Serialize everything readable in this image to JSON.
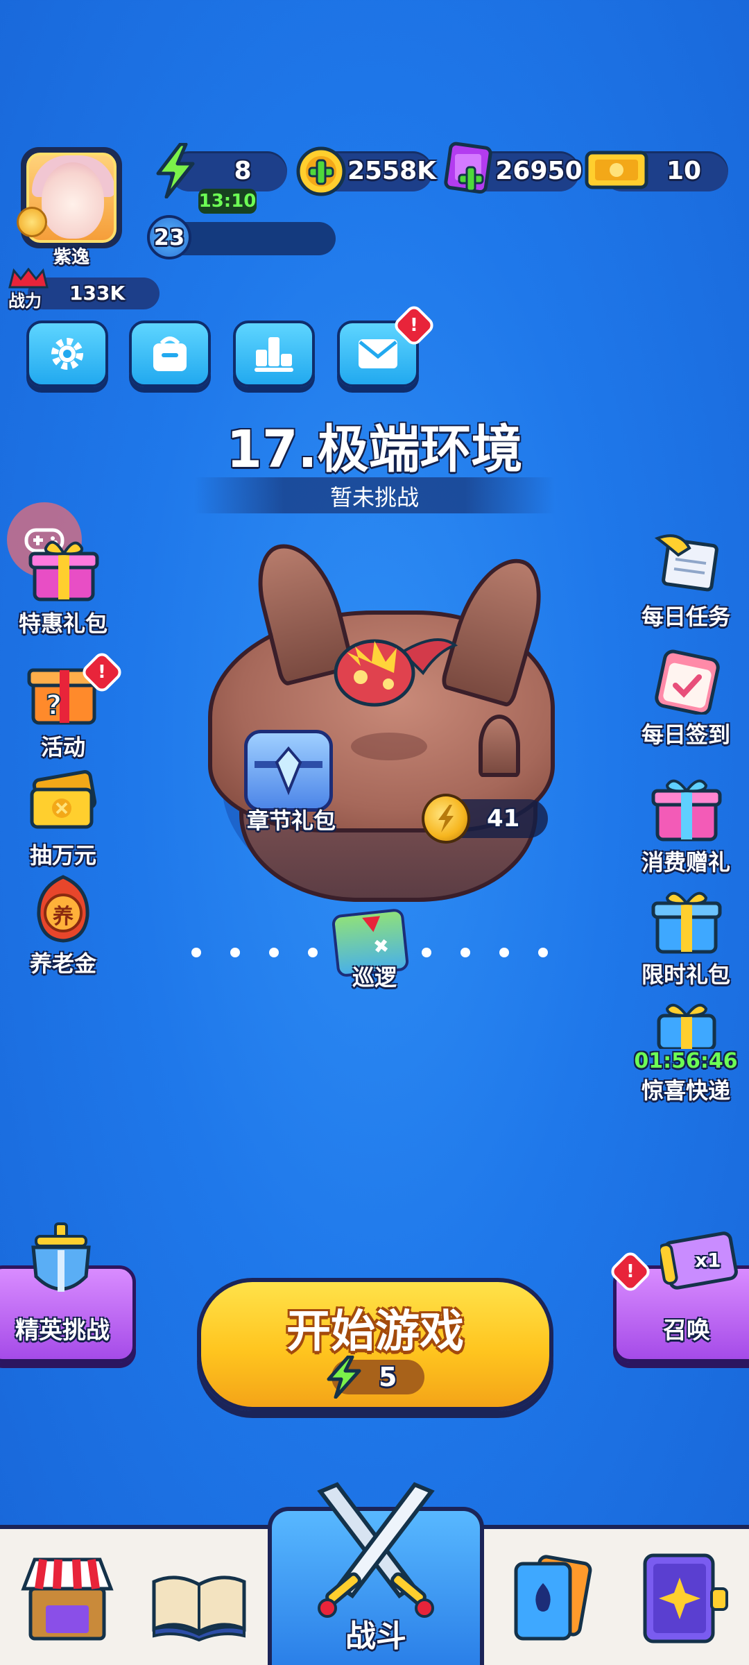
{
  "player": {
    "name": "紫逸",
    "level": "23",
    "level_progress": 0.12,
    "power_label": "战力",
    "power_value": "133K"
  },
  "resources": {
    "energy": "8",
    "energy_timer": "13:10",
    "coins": "2558K",
    "gems": "26950",
    "tickets": "10"
  },
  "menu_buttons": [
    "settings-icon",
    "shop-bag-icon",
    "leaderboard-icon",
    "mail-icon"
  ],
  "stage": {
    "title": "17.极端环境",
    "status": "暂未挑战",
    "chest_label": "章节礼包",
    "coin_reward": "41",
    "patrol_label": "巡逻"
  },
  "left_side": [
    {
      "label": "特惠礼包",
      "icon": "gift-box-icon"
    },
    {
      "label": "活动",
      "icon": "event-box-icon",
      "alert": "!"
    },
    {
      "label": "抽万元",
      "icon": "gold-ticket-icon"
    },
    {
      "label": "养老金",
      "icon": "pension-coin-icon",
      "badge_text": "养"
    }
  ],
  "right_side": [
    {
      "label": "每日任务",
      "icon": "scroll-quill-icon"
    },
    {
      "label": "每日签到",
      "icon": "calendar-check-icon"
    },
    {
      "label": "消费赠礼",
      "icon": "pink-gift-icon"
    },
    {
      "label": "限时礼包",
      "icon": "blue-gift-icon"
    },
    {
      "label": "惊喜快递",
      "icon": "delivery-gift-icon",
      "timer": "01:56:46"
    }
  ],
  "actions": {
    "elite_label": "精英挑战",
    "start_label": "开始游戏",
    "start_cost": "5",
    "summon_label": "召唤",
    "summon_badge": "x1",
    "alert": "!"
  },
  "nav": {
    "tabs": [
      "shop-icon",
      "book-icon",
      "battle-icon",
      "cards-icon",
      "spellbook-icon"
    ],
    "active_label": "战斗"
  },
  "colors": {
    "background": "#1f78ea",
    "start_button": "#ffc51f",
    "purple_button": "#a54be8",
    "alert_red": "#e8243a",
    "timer_green": "#6dff55"
  }
}
